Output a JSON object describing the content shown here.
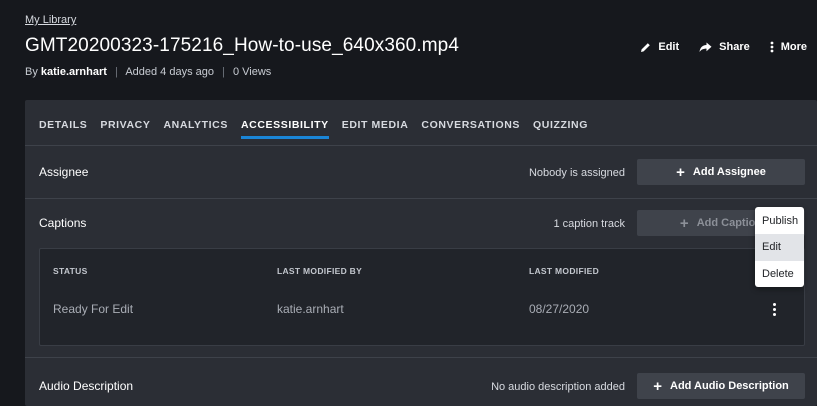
{
  "header": {
    "breadcrumb": "My Library",
    "title": "GMT20200323-175216_How-to-use_640x360.mp4",
    "meta_prefix": "By",
    "author": "katie.arnhart",
    "added": "Added 4 days ago",
    "views": "0 Views",
    "actions": {
      "edit": "Edit",
      "share": "Share",
      "more": "More"
    }
  },
  "tabs": [
    "DETAILS",
    "PRIVACY",
    "ANALYTICS",
    "ACCESSIBILITY",
    "EDIT MEDIA",
    "CONVERSATIONS",
    "QUIZZING"
  ],
  "active_tab": "ACCESSIBILITY",
  "assignee": {
    "label": "Assignee",
    "status": "Nobody is assigned",
    "button": "Add Assignee"
  },
  "captions": {
    "label": "Captions",
    "status": "1 caption track",
    "button": "Add Caption",
    "table": {
      "columns": [
        "STATUS",
        "LAST MODIFIED BY",
        "LAST MODIFIED"
      ],
      "rows": [
        [
          "Ready For Edit",
          "katie.arnhart",
          "08/27/2020"
        ]
      ]
    }
  },
  "row_menu": {
    "items": [
      "Publish",
      "Edit",
      "Delete"
    ],
    "highlighted": "Edit"
  },
  "audio_description": {
    "label": "Audio Description",
    "status": "No audio description added",
    "button": "Add Audio Description"
  },
  "colors": {
    "background": "#16181d",
    "panel": "#2b2e35",
    "accent": "#1a85d6",
    "button": "#3f434b"
  }
}
